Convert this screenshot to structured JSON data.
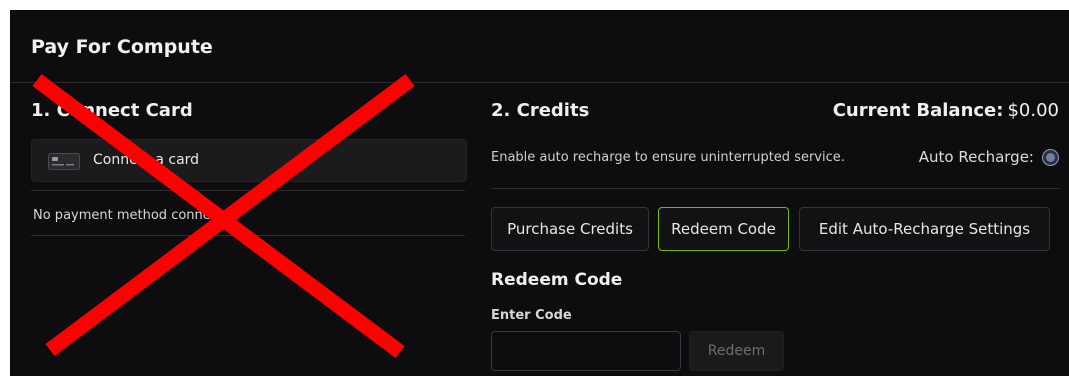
{
  "header": {
    "title": "Pay For Compute"
  },
  "left": {
    "title": "1. Connect Card",
    "connect_button_label": "Connect a card",
    "card_icon": "credit-card-icon",
    "status_text": "No payment method connected"
  },
  "right": {
    "title": "2. Credits",
    "balance_label": "Current Balance:",
    "balance_value": "$0.00",
    "auto_description": "Enable auto recharge to ensure uninterrupted service.",
    "auto_recharge_label": "Auto Recharge:",
    "actions": {
      "purchase": "Purchase Credits",
      "redeem": "Redeem Code",
      "edit_auto": "Edit Auto-Recharge Settings"
    },
    "redeem_section": {
      "title": "Redeem Code",
      "input_label": "Enter Code",
      "input_value": "",
      "button_label": "Redeem"
    }
  },
  "colors": {
    "background": "#0d0d0f",
    "accent_border": "#76b900",
    "overlay_x": "#ff0000"
  }
}
